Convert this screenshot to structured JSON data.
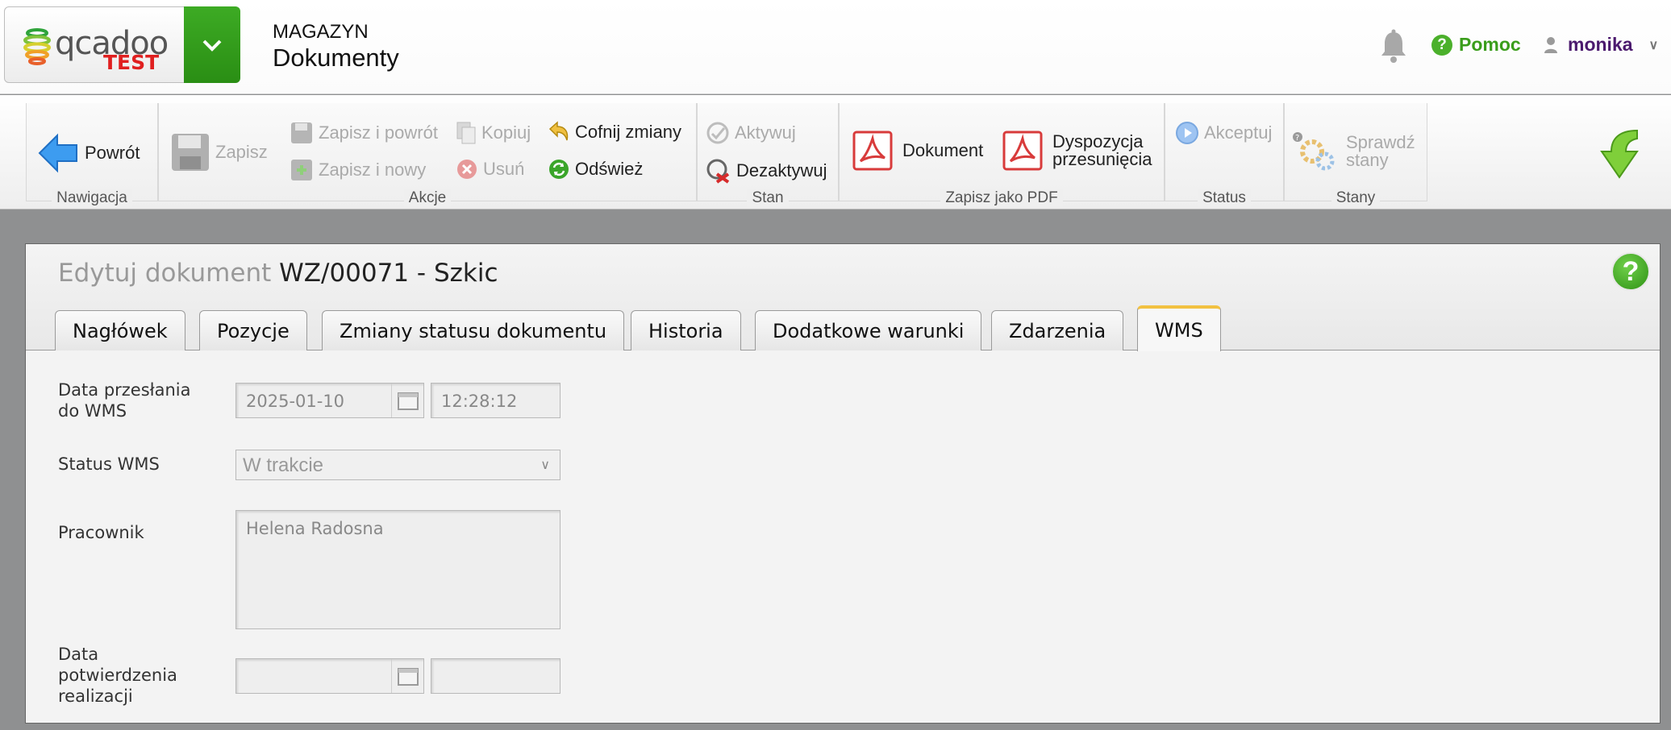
{
  "header": {
    "logo_text": "qcadoo",
    "logo_sub": "TEST",
    "module": "MAGAZYN",
    "page": "Dokumenty",
    "help": "Pomoc",
    "user": "monika"
  },
  "ribbon": {
    "groups": {
      "nav": "Nawigacja",
      "actions": "Akcje",
      "state": "Stan",
      "pdf": "Zapisz jako PDF",
      "status": "Status",
      "stocks": "Stany"
    },
    "buttons": {
      "back": "Powrót",
      "save": "Zapisz",
      "save_back": "Zapisz i powrót",
      "save_new": "Zapisz i nowy",
      "copy": "Kopiuj",
      "delete": "Usuń",
      "undo": "Cofnij zmiany",
      "refresh": "Odśwież",
      "activate": "Aktywuj",
      "deactivate": "Dezaktywuj",
      "pdf_document": "Dokument",
      "pdf_disposition_1": "Dyspozycja",
      "pdf_disposition_2": "przesunięcia",
      "accept": "Akceptuj",
      "check_1": "Sprawdź",
      "check_2": "stany"
    }
  },
  "panel": {
    "title_prefix": "Edytuj dokument",
    "title_doc": "WZ/00071 - Szkic",
    "tabs": [
      "Nagłówek",
      "Pozycje",
      "Zmiany statusu dokumentu",
      "Historia",
      "Dodatkowe warunki",
      "Zdarzenia",
      "WMS"
    ],
    "active_tab": "WMS"
  },
  "form": {
    "send_date_label_1": "Data przesłania",
    "send_date_label_2": "do WMS",
    "send_date": "2025-01-10",
    "send_time": "12:28:12",
    "status_label": "Status WMS",
    "status_value": "W trakcie",
    "employee_label": "Pracownik",
    "employee_value": "Helena Radosna",
    "confirm_label_1": "Data",
    "confirm_label_2": "potwierdzenia",
    "confirm_label_3": "realizacji",
    "confirm_date": "",
    "confirm_time": ""
  },
  "colors": {
    "brand_green": "#2a8e14",
    "help_green": "#3a9d1b",
    "user_purple": "#4b1a6e",
    "active_tab_accent": "#f2c141"
  }
}
